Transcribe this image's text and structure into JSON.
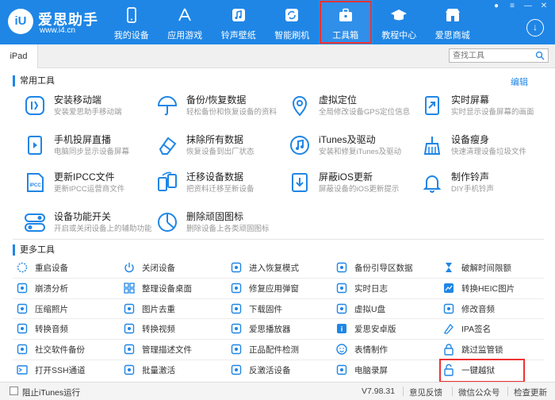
{
  "app": {
    "logo_mark": "iU",
    "logo_title": "爱思助手",
    "logo_url": "www.i4.cn"
  },
  "nav": [
    {
      "label": "我的设备",
      "icon": "phone-icon"
    },
    {
      "label": "应用游戏",
      "icon": "app-store-icon"
    },
    {
      "label": "铃声壁纸",
      "icon": "music-note-icon"
    },
    {
      "label": "智能刷机",
      "icon": "refresh-icon"
    },
    {
      "label": "工具箱",
      "icon": "toolbox-icon",
      "active": true
    },
    {
      "label": "教程中心",
      "icon": "graduation-cap-icon"
    },
    {
      "label": "爱思商城",
      "icon": "shop-icon"
    }
  ],
  "tabs": {
    "device": "iPad",
    "search_placeholder": "查找工具"
  },
  "sections": {
    "common": "常用工具",
    "more": "更多工具",
    "edit": "编辑"
  },
  "common_tools": [
    {
      "name": "安装移动端",
      "desc": "安装爱思助手移动端",
      "icon": "i4-app-icon"
    },
    {
      "name": "备份/恢复数据",
      "desc": "轻松备份和恢复设备的资料",
      "icon": "umbrella-icon"
    },
    {
      "name": "虚拟定位",
      "desc": "全局修改设备GPS定位信息",
      "icon": "location-pin-icon"
    },
    {
      "name": "实时屏幕",
      "desc": "实时显示设备屏幕的画面",
      "icon": "screen-share-icon"
    },
    {
      "name": "手机投屏直播",
      "desc": "电脑同步显示设备屏幕",
      "icon": "screen-cast-icon"
    },
    {
      "name": "抹除所有数据",
      "desc": "恢复设备到出厂状态",
      "icon": "eraser-icon"
    },
    {
      "name": "iTunes及驱动",
      "desc": "安装和修复iTunes及驱动",
      "icon": "itunes-icon"
    },
    {
      "name": "设备瘦身",
      "desc": "快速清理设备垃圾文件",
      "icon": "broom-icon"
    },
    {
      "name": "更新IPCC文件",
      "desc": "更新IPCC运营商文件",
      "icon": "ipcc-file-icon"
    },
    {
      "name": "迁移设备数据",
      "desc": "把资料迁移至新设备",
      "icon": "migrate-icon"
    },
    {
      "name": "屏蔽iOS更新",
      "desc": "屏蔽设备的iOS更新提示",
      "icon": "block-update-icon"
    },
    {
      "name": "制作铃声",
      "desc": "DIY手机铃声",
      "icon": "bell-icon"
    },
    {
      "name": "设备功能开关",
      "desc": "开启或关闭设备上的辅助功能",
      "icon": "toggle-icon"
    },
    {
      "name": "删除顽固图标",
      "desc": "删除设备上各类顽固图标",
      "icon": "pie-chart-icon"
    }
  ],
  "more_tools": [
    {
      "name": "重启设备",
      "icon": "restart-icon"
    },
    {
      "name": "关闭设备",
      "icon": "power-icon"
    },
    {
      "name": "进入恢复模式",
      "icon": "recovery-icon"
    },
    {
      "name": "备份引导区数据",
      "icon": "backup-icon"
    },
    {
      "name": "破解时间限额",
      "icon": "hourglass-icon"
    },
    {
      "name": "崩溃分析",
      "icon": "chart-icon"
    },
    {
      "name": "整理设备桌面",
      "icon": "grid-icon"
    },
    {
      "name": "修复应用弹窗",
      "icon": "repair-icon"
    },
    {
      "name": "实时日志",
      "icon": "log-icon"
    },
    {
      "name": "转换HEIC图片",
      "icon": "heic-icon"
    },
    {
      "name": "压缩照片",
      "icon": "compress-icon"
    },
    {
      "name": "图片去重",
      "icon": "duplicate-icon"
    },
    {
      "name": "下载固件",
      "icon": "download-icon"
    },
    {
      "name": "虚拟U盘",
      "icon": "usb-icon"
    },
    {
      "name": "修改音频",
      "icon": "audio-icon"
    },
    {
      "name": "转换音频",
      "icon": "convert-audio-icon"
    },
    {
      "name": "转换视频",
      "icon": "video-icon"
    },
    {
      "name": "爱思播放器",
      "icon": "player-icon"
    },
    {
      "name": "爱思安卓版",
      "icon": "android-icon"
    },
    {
      "name": "IPA签名",
      "icon": "signature-icon"
    },
    {
      "name": "社交软件备份",
      "icon": "social-backup-icon"
    },
    {
      "name": "管理描述文件",
      "icon": "profile-icon"
    },
    {
      "name": "正品配件检测",
      "icon": "accessory-icon"
    },
    {
      "name": "表情制作",
      "icon": "emoji-icon"
    },
    {
      "name": "跳过监管锁",
      "icon": "lock-icon"
    },
    {
      "name": "打开SSH通道",
      "icon": "ssh-icon"
    },
    {
      "name": "批量激活",
      "icon": "batch-icon"
    },
    {
      "name": "反激活设备",
      "icon": "deactivate-icon"
    },
    {
      "name": "电脑录屏",
      "icon": "record-icon"
    },
    {
      "name": "一键越狱",
      "icon": "jailbreak-icon",
      "highlight": true
    }
  ],
  "footer": {
    "block_itunes": "阻止iTunes运行",
    "version": "V7.98.31",
    "feedback": "意见反馈",
    "wechat": "微信公众号",
    "update": "检查更新"
  },
  "colors": {
    "brand": "#1f86e6",
    "highlight_border": "#e33"
  }
}
